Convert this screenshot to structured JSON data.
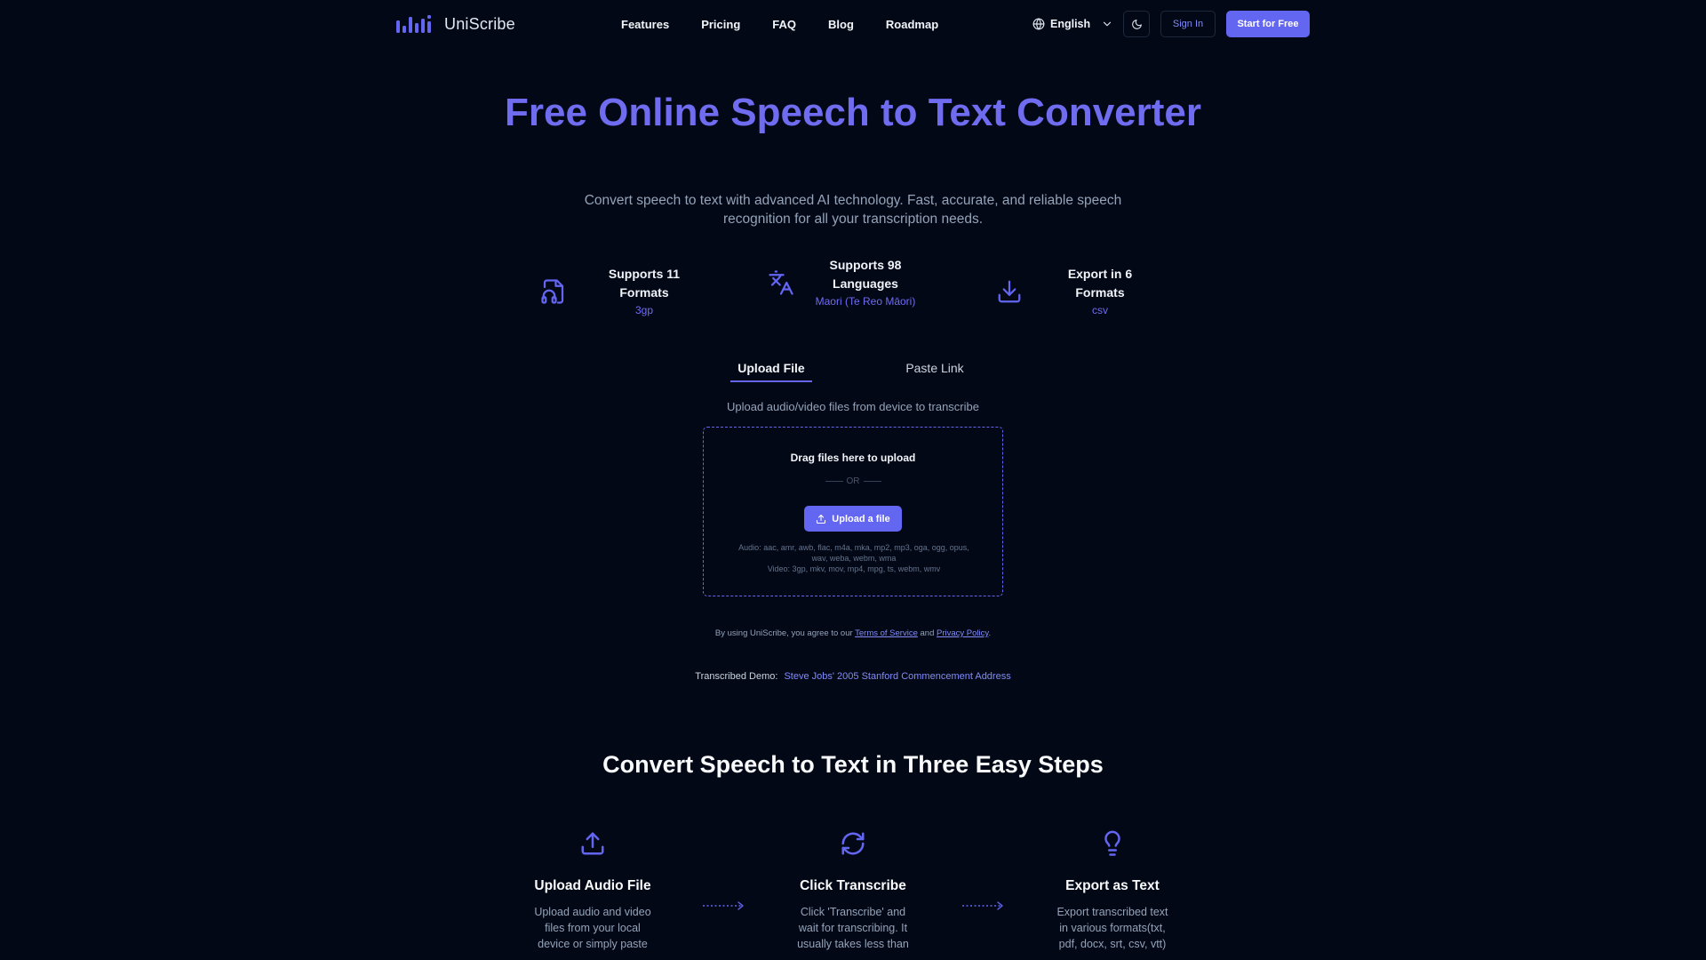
{
  "brand": {
    "name": "UniScribe",
    "accent": "#6366f1"
  },
  "nav": {
    "items": [
      "Features",
      "Pricing",
      "FAQ",
      "Blog",
      "Roadmap"
    ]
  },
  "header": {
    "language": "English",
    "sign_in": "Sign In",
    "start_free": "Start for Free"
  },
  "hero": {
    "title": "Free Online Speech to Text Converter",
    "subtitle": "Convert speech to text with advanced AI technology. Fast, accurate, and reliable speech recognition for all your transcription needs."
  },
  "stats": [
    {
      "icon": "audio-file-icon",
      "title": "Supports 11 Formats",
      "value": "3gp"
    },
    {
      "icon": "translate-icon",
      "title": "Supports 98 Languages",
      "value": "Maori (Te Reo Māori)"
    },
    {
      "icon": "download-icon",
      "title": "Export in 6 Formats",
      "value": "csv"
    }
  ],
  "tabs": {
    "upload": "Upload File",
    "paste": "Paste Link"
  },
  "upload": {
    "description": "Upload audio/video files from device to transcribe",
    "drag_text": "Drag files here to upload",
    "or_text": "OR",
    "button": "Upload a file",
    "audio_formats": "Audio: aac, amr, awb, flac, m4a, mka, mp2, mp3, oga, ogg, opus, wav, weba, webm, wma",
    "video_formats": "Video: 3gp, mkv, mov, mp4, mpg, ts, webm, wmv"
  },
  "terms": {
    "prefix": "By using UniScribe, you agree to our",
    "tos": "Terms of Service",
    "and": "and",
    "privacy": "Privacy Policy",
    "suffix": "."
  },
  "demo": {
    "label": "Transcribed Demo:",
    "link": "Steve Jobs' 2005 Stanford Commencement Address"
  },
  "steps": {
    "title": "Convert Speech to Text in Three Easy Steps",
    "items": [
      {
        "icon": "upload-icon",
        "title": "Upload Audio File",
        "desc": "Upload audio and video files from your local device or simply paste"
      },
      {
        "icon": "refresh-icon",
        "title": "Click Transcribe",
        "desc": "Click 'Transcribe' and wait for transcribing. It usually takes less than"
      },
      {
        "icon": "lightbulb-icon",
        "title": "Export as Text",
        "desc": "Export transcribed text in various formats(txt, pdf, docx, srt, csv, vtt)"
      }
    ]
  }
}
